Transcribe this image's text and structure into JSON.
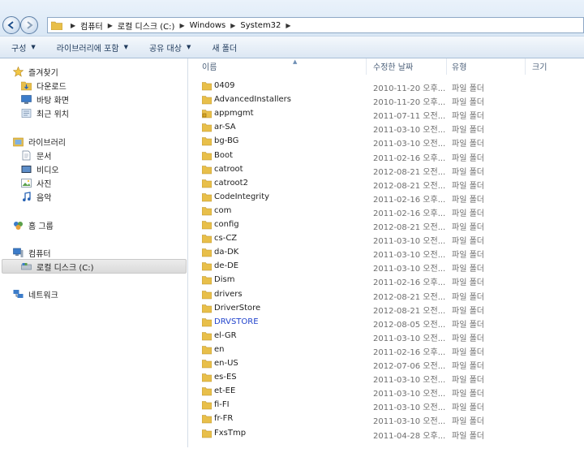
{
  "address": {
    "crumbs": [
      "컴퓨터",
      "로컬 디스크 (C:)",
      "Windows",
      "System32"
    ]
  },
  "toolbar": {
    "organize": "구성",
    "include_library": "라이브러리에 포함",
    "share_with": "공유 대상",
    "new_folder": "새 폴더"
  },
  "sidebar": {
    "favorites": "즐겨찾기",
    "downloads": "다운로드",
    "desktop": "바탕 화면",
    "recent": "최근 위치",
    "libraries": "라이브러리",
    "documents": "문서",
    "videos": "비디오",
    "pictures": "사진",
    "music": "음악",
    "homegroup": "홈 그룹",
    "computer": "컴퓨터",
    "local_disk": "로컬 디스크 (C:)",
    "network": "네트워크"
  },
  "columns": {
    "name": "이름",
    "date_modified": "수정한 날짜",
    "type": "유형",
    "size": "크기"
  },
  "files": [
    {
      "name": "0409",
      "date": "2010-11-20 오후...",
      "type": "파일 폴더",
      "icon": "folder-icon"
    },
    {
      "name": "AdvancedInstallers",
      "date": "2010-11-20 오후...",
      "type": "파일 폴더",
      "icon": "folder-icon"
    },
    {
      "name": "appmgmt",
      "date": "2011-07-11 오전...",
      "type": "파일 폴더",
      "icon": "locked-folder-icon"
    },
    {
      "name": "ar-SA",
      "date": "2011-03-10 오전...",
      "type": "파일 폴더",
      "icon": "folder-icon"
    },
    {
      "name": "bg-BG",
      "date": "2011-03-10 오전...",
      "type": "파일 폴더",
      "icon": "folder-icon"
    },
    {
      "name": "Boot",
      "date": "2011-02-16 오후...",
      "type": "파일 폴더",
      "icon": "folder-icon"
    },
    {
      "name": "catroot",
      "date": "2012-08-21 오전...",
      "type": "파일 폴더",
      "icon": "folder-icon"
    },
    {
      "name": "catroot2",
      "date": "2012-08-21 오전...",
      "type": "파일 폴더",
      "icon": "folder-icon"
    },
    {
      "name": "CodeIntegrity",
      "date": "2011-02-16 오후...",
      "type": "파일 폴더",
      "icon": "folder-icon"
    },
    {
      "name": "com",
      "date": "2011-02-16 오후...",
      "type": "파일 폴더",
      "icon": "folder-icon"
    },
    {
      "name": "config",
      "date": "2012-08-21 오전...",
      "type": "파일 폴더",
      "icon": "folder-icon"
    },
    {
      "name": "cs-CZ",
      "date": "2011-03-10 오전...",
      "type": "파일 폴더",
      "icon": "folder-icon"
    },
    {
      "name": "da-DK",
      "date": "2011-03-10 오전...",
      "type": "파일 폴더",
      "icon": "folder-icon"
    },
    {
      "name": "de-DE",
      "date": "2011-03-10 오전...",
      "type": "파일 폴더",
      "icon": "folder-icon"
    },
    {
      "name": "Dism",
      "date": "2011-02-16 오후...",
      "type": "파일 폴더",
      "icon": "folder-icon"
    },
    {
      "name": "drivers",
      "date": "2012-08-21 오전...",
      "type": "파일 폴더",
      "icon": "folder-icon"
    },
    {
      "name": "DriverStore",
      "date": "2012-08-21 오전...",
      "type": "파일 폴더",
      "icon": "folder-icon"
    },
    {
      "name": "DRVSTORE",
      "date": "2012-08-05 오전...",
      "type": "파일 폴더",
      "icon": "folder-icon",
      "link": true
    },
    {
      "name": "el-GR",
      "date": "2011-03-10 오전...",
      "type": "파일 폴더",
      "icon": "folder-icon"
    },
    {
      "name": "en",
      "date": "2011-02-16 오후...",
      "type": "파일 폴더",
      "icon": "folder-icon"
    },
    {
      "name": "en-US",
      "date": "2012-07-06 오전...",
      "type": "파일 폴더",
      "icon": "folder-icon"
    },
    {
      "name": "es-ES",
      "date": "2011-03-10 오전...",
      "type": "파일 폴더",
      "icon": "folder-icon"
    },
    {
      "name": "et-EE",
      "date": "2011-03-10 오전...",
      "type": "파일 폴더",
      "icon": "folder-icon"
    },
    {
      "name": "fi-FI",
      "date": "2011-03-10 오전...",
      "type": "파일 폴더",
      "icon": "folder-icon"
    },
    {
      "name": "fr-FR",
      "date": "2011-03-10 오전...",
      "type": "파일 폴더",
      "icon": "folder-icon"
    },
    {
      "name": "FxsTmp",
      "date": "2011-04-28 오후...",
      "type": "파일 폴더",
      "icon": "folder-icon"
    }
  ],
  "colors": {
    "folder": "#e8bf4a",
    "link_text": "#2244cc",
    "toolbar_text": "#1e395b"
  }
}
